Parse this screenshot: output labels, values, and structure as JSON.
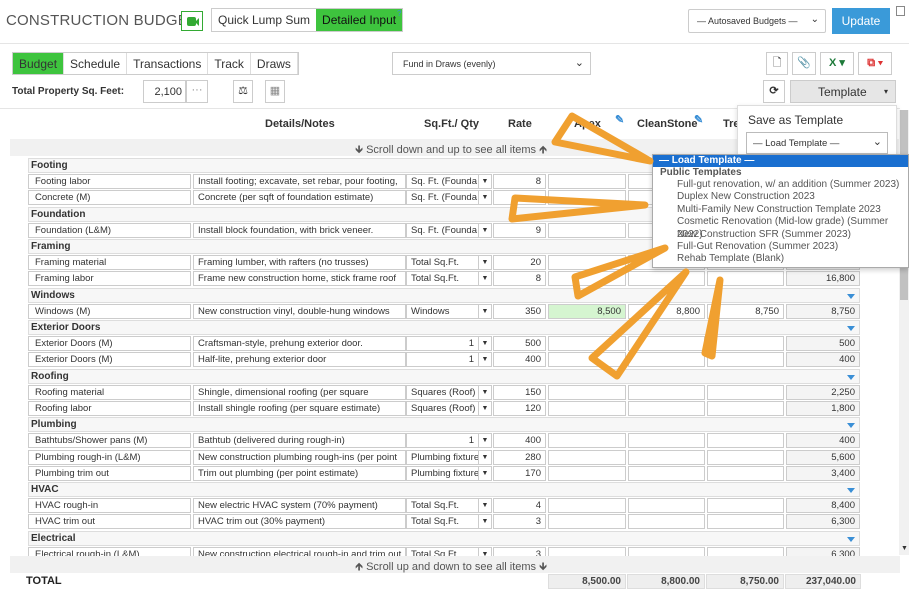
{
  "header": {
    "title": "CONSTRUCTION BUDGET",
    "modes": [
      "Quick Lump Sum",
      "Detailed Input"
    ],
    "active_mode": "Detailed Input",
    "help": "?",
    "autosaved": "— Autosaved Budgets —",
    "update": "Update"
  },
  "toolbar": {
    "tabs": [
      "Budget",
      "Schedule",
      "Transactions",
      "Track",
      "Draws"
    ],
    "active_tab": "Budget",
    "fund": "Fund in Draws (evenly)",
    "sqft_label": "Total Property Sq. Feet:",
    "sqft_value": "2,100",
    "sqft_more": "···",
    "template": "Template"
  },
  "columns": {
    "notes": "Details/Notes",
    "qty": "Sq.Ft./ Qty",
    "rate": "Rate",
    "apex": "Apex",
    "cleanstone": "CleanStone",
    "tre": "Tre"
  },
  "scroll_top": "🡻 Scroll down and up to see all items 🡹",
  "scroll_bottom": "🡹 Scroll up and down to see all items 🡻",
  "sections": [
    {
      "name": "Footing",
      "items": [
        {
          "name": "Footing labor",
          "notes": "Install footing; excavate, set rebar, pour footing,",
          "qty": "Sq. Ft. (Founda",
          "rate": "8"
        },
        {
          "name": "Concrete (M)",
          "notes": "Concrete (per sqft of foundation estimate)",
          "qty": "Sq. Ft. (Founda",
          "rate": ""
        }
      ]
    },
    {
      "name": "Foundation",
      "items": [
        {
          "name": "Foundation (L&M)",
          "notes": "Install block foundation, with brick veneer.",
          "qty": "Sq. Ft. (Founda",
          "rate": "9"
        }
      ]
    },
    {
      "name": "Framing",
      "items": [
        {
          "name": "Framing material",
          "notes": "Framing lumber, with rafters (no trusses)",
          "qty": "Total Sq.Ft.",
          "rate": "20"
        },
        {
          "name": "Framing labor",
          "notes": "Frame new construction home, stick frame roof",
          "qty": "Total Sq.Ft.",
          "rate": "8",
          "total": "16,800"
        }
      ]
    },
    {
      "name": "Windows",
      "items": [
        {
          "name": "Windows (M)",
          "notes": "New construction vinyl, double-hung windows",
          "qty": "Windows",
          "rate": "350",
          "apex": "8,500",
          "cleanstone": "8,800",
          "tre": "8,750",
          "total": "8,750"
        }
      ]
    },
    {
      "name": "Exterior Doors",
      "items": [
        {
          "name": "Exterior Doors (M)",
          "notes": "Craftsman-style, prehung exterior door.",
          "qty": "1",
          "rate": "500",
          "total": "500"
        },
        {
          "name": "Exterior Doors (M)",
          "notes": "Half-lite, prehung exterior door",
          "qty": "1",
          "rate": "400",
          "total": "400"
        }
      ]
    },
    {
      "name": "Roofing",
      "items": [
        {
          "name": "Roofing material",
          "notes": "Shingle, dimensional roofing (per square",
          "qty": "Squares (Roof)",
          "rate": "150",
          "total": "2,250"
        },
        {
          "name": "Roofing labor",
          "notes": "Install shingle roofing (per square estimate)",
          "qty": "Squares (Roof)",
          "rate": "120",
          "total": "1,800"
        }
      ]
    },
    {
      "name": "Plumbing",
      "items": [
        {
          "name": "Bathtubs/Shower pans (M)",
          "notes": "Bathtub (delivered during rough-in)",
          "qty": "1",
          "rate": "400",
          "total": "400"
        },
        {
          "name": "Plumbing rough-in (L&M)",
          "notes": "New construction plumbing rough-ins (per point",
          "qty": "Plumbing fixture",
          "rate": "280",
          "total": "5,600"
        },
        {
          "name": "Plumbing trim out",
          "notes": "Trim out plumbing (per point estimate)",
          "qty": "Plumbing fixture",
          "rate": "170",
          "total": "3,400"
        }
      ]
    },
    {
      "name": "HVAC",
      "items": [
        {
          "name": "HVAC rough-in",
          "notes": "New electric HVAC system (70% payment)",
          "qty": "Total Sq.Ft.",
          "rate": "4",
          "total": "8,400"
        },
        {
          "name": "HVAC trim out",
          "notes": "HVAC trim out (30% payment)",
          "qty": "Total Sq.Ft.",
          "rate": "3",
          "total": "6,300"
        }
      ]
    },
    {
      "name": "Electrical",
      "items": [
        {
          "name": "Electrical rough-in (L&M)",
          "notes": "New construction electrical rough-in and trim out",
          "qty": "Total Sq.Ft.",
          "rate": "3",
          "total": "6,300"
        }
      ]
    }
  ],
  "totals": {
    "label": "TOTAL",
    "apex": "8,500.00",
    "cleanstone": "8,800.00",
    "tre": "8,750.00",
    "total": "237,040.00"
  },
  "template_menu": {
    "save": "Save as Template",
    "load": "— Load Template —"
  },
  "template_popup": {
    "selected": "— Load Template —",
    "group": "Public Templates",
    "options": [
      "Full-gut renovation, w/ an addition (Summer 2023)",
      "Duplex New Construction 2023",
      "Multi-Family New Construction Template 2023",
      "Cosmetic Renovation (Mid-low grade) (Summer 2022)",
      "New Construction SFR (Summer 2023)",
      "Full-Gut Renovation (Summer 2023)",
      "Rehab Template (Blank)"
    ]
  },
  "colors": {
    "accent_green": "#3ec43e",
    "update_blue": "#3a9ad9",
    "highlight_green": "#d5f5d0",
    "annotation": "#f0a030",
    "select_blue": "#1a6fd0"
  }
}
